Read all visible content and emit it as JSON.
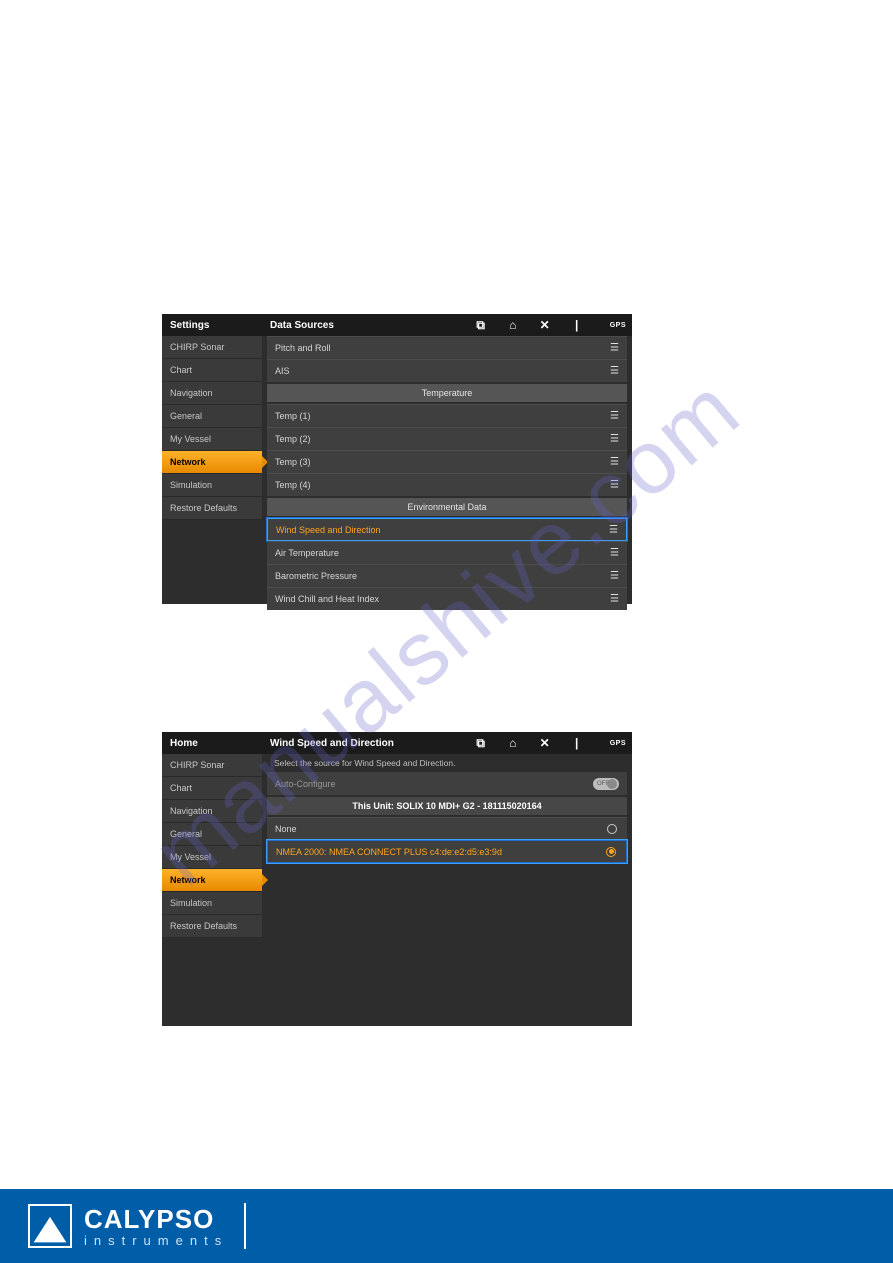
{
  "watermark": "manualshive.com",
  "screenshot1": {
    "topbar_left": "Settings",
    "topbar_main": "Data Sources",
    "gps_label": "GPS",
    "sidebar": [
      {
        "label": "CHIRP Sonar",
        "active": false
      },
      {
        "label": "Chart",
        "active": false
      },
      {
        "label": "Navigation",
        "active": false
      },
      {
        "label": "General",
        "active": false
      },
      {
        "label": "My Vessel",
        "active": false
      },
      {
        "label": "Network",
        "active": true
      },
      {
        "label": "Simulation",
        "active": false
      },
      {
        "label": "Restore Defaults",
        "active": false
      }
    ],
    "rows_top": [
      {
        "label": "Pitch and Roll"
      },
      {
        "label": "AIS"
      }
    ],
    "section_temperature": "Temperature",
    "rows_temp": [
      {
        "label": "Temp (1)"
      },
      {
        "label": "Temp (2)"
      },
      {
        "label": "Temp (3)"
      },
      {
        "label": "Temp (4)"
      }
    ],
    "section_env": "Environmental Data",
    "rows_env": [
      {
        "label": "Wind Speed and Direction",
        "highlight": true
      },
      {
        "label": "Air Temperature"
      },
      {
        "label": "Barometric Pressure"
      },
      {
        "label": "Wind Chill and Heat Index"
      }
    ]
  },
  "screenshot2": {
    "topbar_left": "Home",
    "topbar_main": "Wind Speed and Direction",
    "gps_label": "GPS",
    "instruction": "Select the source for Wind Speed and Direction.",
    "auto_configure": "Auto-Configure",
    "toggle_state": "OFF",
    "unit_header": "This Unit: SOLIX 10 MDI+ G2 - 181115020164",
    "option_none": "None",
    "option_nmea": "NMEA 2000: NMEA CONNECT PLUS  c4:de:e2:d5:e3:9d",
    "sidebar": [
      {
        "label": "CHIRP Sonar",
        "active": false
      },
      {
        "label": "Chart",
        "active": false
      },
      {
        "label": "Navigation",
        "active": false
      },
      {
        "label": "General",
        "active": false
      },
      {
        "label": "My Vessel",
        "active": false
      },
      {
        "label": "Network",
        "active": true
      },
      {
        "label": "Simulation",
        "active": false
      },
      {
        "label": "Restore Defaults",
        "active": false
      }
    ]
  },
  "footer": {
    "brand_top": "CALYPSO",
    "brand_bottom": "instruments"
  }
}
